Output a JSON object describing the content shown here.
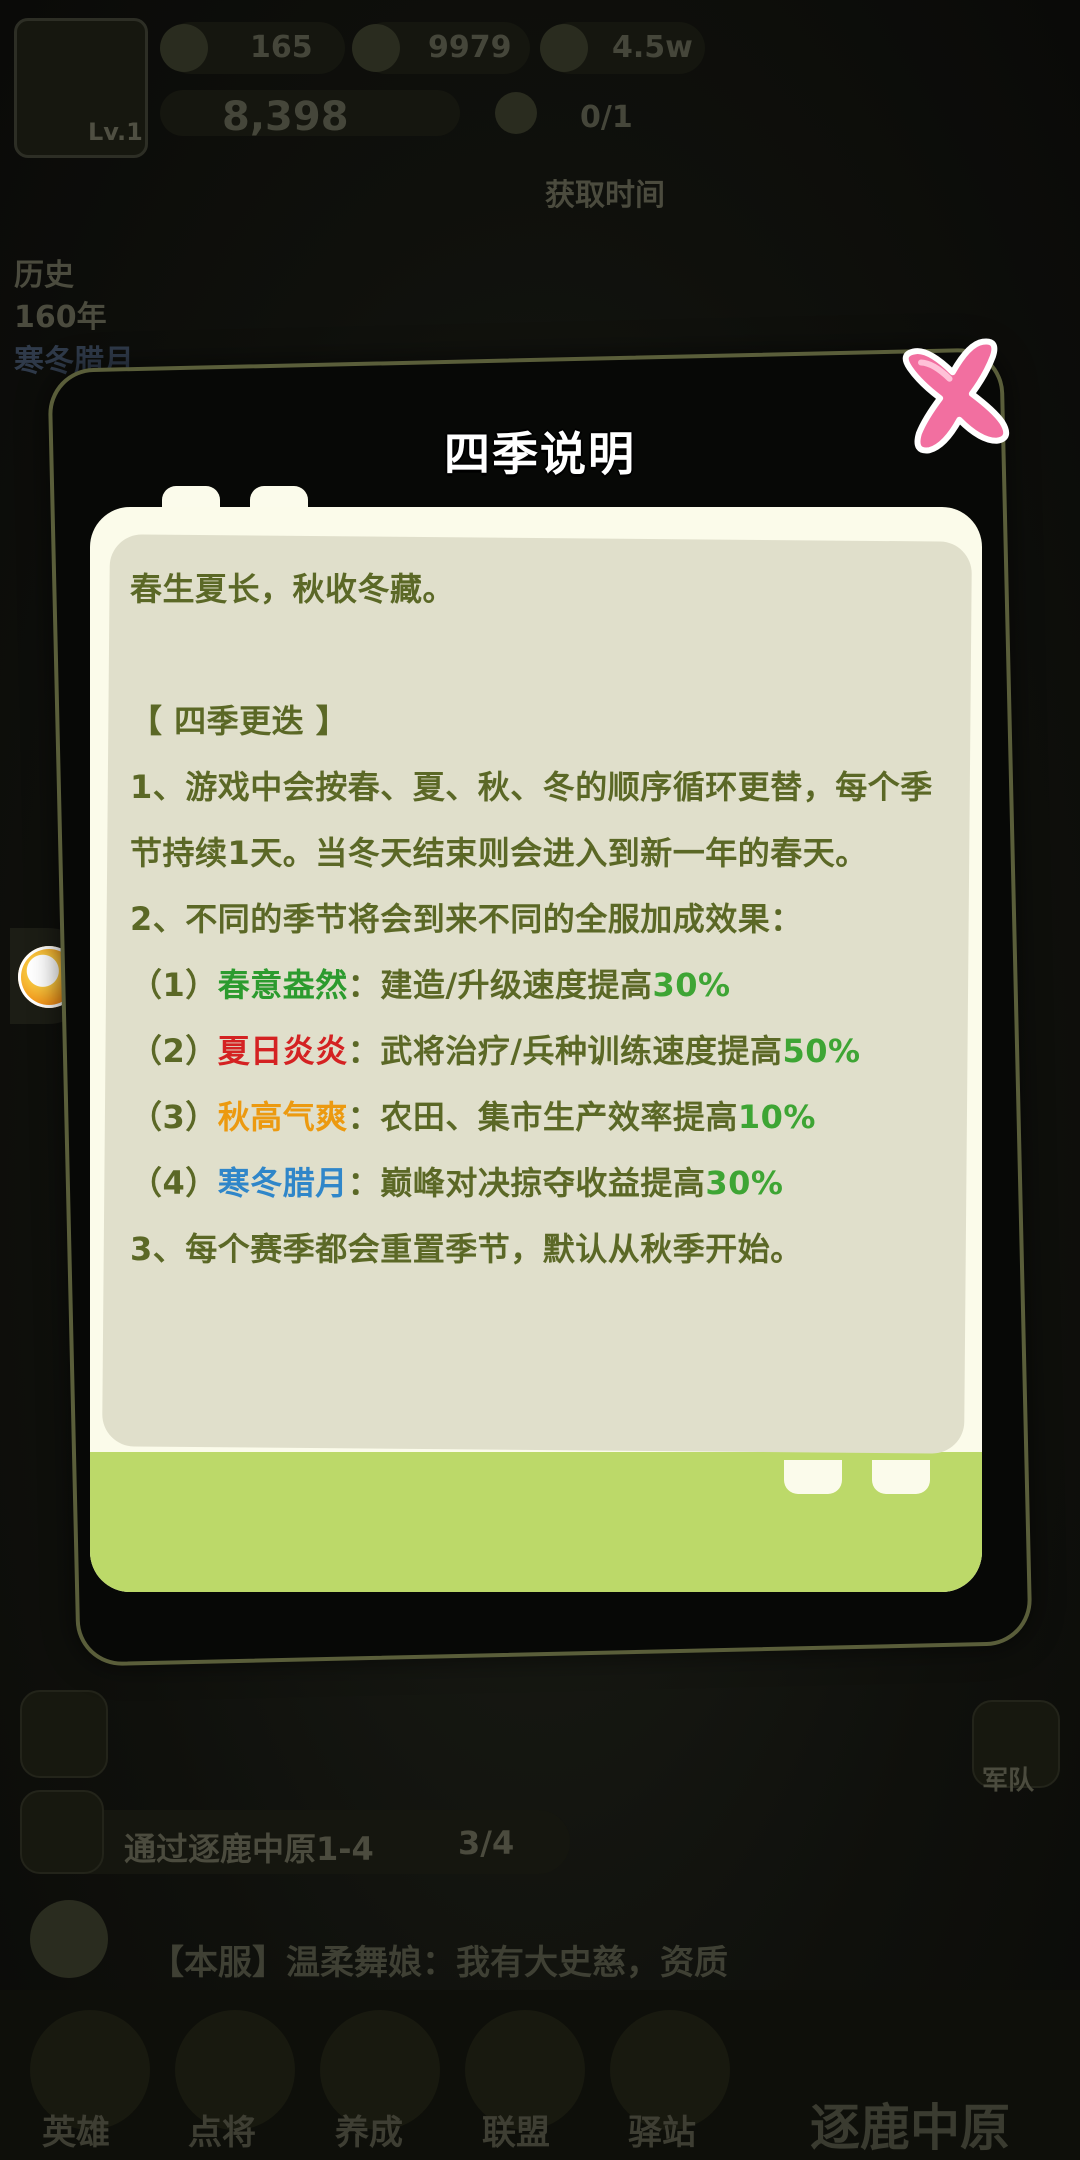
{
  "hud": {
    "level": "Lv.1",
    "res1": "165",
    "res2": "9979",
    "res3": "4.5w",
    "power": "8,398",
    "troops": "0/1",
    "get_time": "获取时间",
    "era_label": "历史",
    "year": "160年",
    "season": "寒冬腊月",
    "quest": "通过逐鹿中原1-4",
    "quest_progress": "3/4",
    "chat": "【本服】温柔舞娘：我有大史慈，资质",
    "bottom_tabs": [
      "英雄",
      "点将",
      "养成",
      "联盟",
      "驿站"
    ],
    "bottom_right": "逐鹿中原",
    "side_label": "军队"
  },
  "modal": {
    "title": "四季说明",
    "close_icon": "pink-x-close-icon",
    "intro": "春生夏长，秋收冬藏。",
    "section_title": "【 四季更迭 】",
    "rule1": "1、游戏中会按春、夏、秋、冬的顺序循环更替，每个季节持续1天。当冬天结束则会进入到新一年的春天。",
    "rule2": "2、不同的季节将会到来不同的全服加成效果：",
    "effects": [
      {
        "prefix": "（1）",
        "name": "春意盎然",
        "sep": "：",
        "desc": "建造/升级速度提高",
        "value": "30%",
        "color": "#2c9b2e"
      },
      {
        "prefix": "（2）",
        "name": "夏日炎炎",
        "sep": "：",
        "desc": "武将治疗/兵种训练速度提高",
        "value": "50%",
        "color": "#d42222"
      },
      {
        "prefix": "（3）",
        "name": "秋高气爽",
        "sep": "：",
        "desc": "农田、集市生产效率提高",
        "value": "10%",
        "color": "#ec9a10"
      },
      {
        "prefix": "（4）",
        "name": "寒冬腊月",
        "sep": "：",
        "desc": "巅峰对决掠夺收益提高",
        "value": "30%",
        "color": "#2f86c9"
      }
    ],
    "rule3": "3、每个赛季都会重置季节，默认从秋季开始。"
  }
}
